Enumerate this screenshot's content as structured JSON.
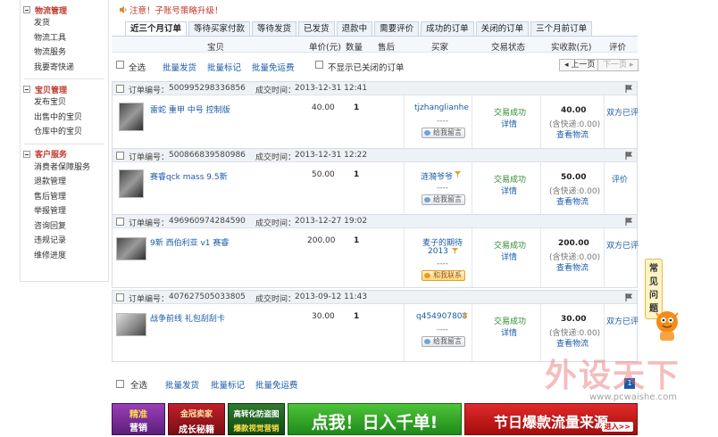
{
  "sidebar": {
    "groups": [
      {
        "title": "物流管理",
        "items": [
          "发货",
          "物流工具",
          "物流服务",
          "我要寄快递"
        ]
      },
      {
        "title": "宝贝管理",
        "items": [
          "发布宝贝",
          "出售中的宝贝",
          "仓库中的宝贝"
        ]
      },
      {
        "title": "客户服务",
        "items": [
          "消费者保障服务",
          "退款管理",
          "售后管理",
          "举报管理",
          "咨询回复",
          "违规记录",
          "维修进度"
        ]
      }
    ]
  },
  "notice": "注意！子账号策略升级！",
  "tabs": [
    "近三个月订单",
    "等待买家付款",
    "等待发货",
    "已发货",
    "退款中",
    "需要评价",
    "成功的订单",
    "关闭的订单",
    "三个月前订单"
  ],
  "columns": {
    "item": "宝贝",
    "price": "单价(元)",
    "qty": "数量",
    "after_sale": "售后",
    "buyer": "买家",
    "status": "交易状态",
    "paid": "实收款(元)",
    "review": "评价"
  },
  "toolbar": {
    "select_all": "全选",
    "batch_ship": "批量发货",
    "batch_mark": "批量标记",
    "batch_free": "批量免运费",
    "hide_closed": "不显示已关闭的订单",
    "prev": "上一页",
    "next": "下一页"
  },
  "orders": [
    {
      "order_label": "订单编号：",
      "order_no": "500995298336856",
      "time_label": "成交时间：",
      "time": "2013-12-31 12:41",
      "item": "雷蛇 重甲 中号 控制版",
      "price": "40.00",
      "qty": "1",
      "buyer": "tjzhanglianhe",
      "buyer2": "",
      "dash": "----",
      "buyer_btn": "给我留言",
      "status": "交易成功",
      "detail": "详情",
      "total": "40.00",
      "shipping": "(含快递:0.00)",
      "logistics": "查看物流",
      "review": "双方已评"
    },
    {
      "order_label": "订单编号：",
      "order_no": "500866839580986",
      "time_label": "成交时间：",
      "time": "2013-12-31 12:22",
      "item": "赛睿qck mass 9.5新",
      "price": "50.00",
      "qty": "1",
      "buyer": "涟漪爷爷",
      "buyer2": "",
      "dash": "----",
      "buyer_btn": "给我留言",
      "status": "交易成功",
      "detail": "详情",
      "total": "50.00",
      "shipping": "(含快递:0.00)",
      "logistics": "查看物流",
      "review": "评价"
    },
    {
      "order_label": "订单编号：",
      "order_no": "496960974284590",
      "time_label": "成交时间：",
      "time": "2013-12-27 19:02",
      "item": "9新 西伯利亚 v1 赛睿",
      "price": "200.00",
      "qty": "1",
      "buyer": "麦子的期待",
      "buyer2": "2013",
      "dash": "----",
      "buyer_btn": "和我联系",
      "status": "交易成功",
      "detail": "详情",
      "total": "200.00",
      "shipping": "(含快递:0.00)",
      "logistics": "查看物流",
      "review": "双方已评"
    },
    {
      "order_label": "订单编号：",
      "order_no": "407627505033805",
      "time_label": "成交时间：",
      "time": "2013-09-12 11:43",
      "item": "战争前线 礼包刮刮卡",
      "price": "30.00",
      "qty": "1",
      "buyer": "q454907808",
      "buyer2": "",
      "dash": "----",
      "buyer_btn": "给我留言",
      "status": "交易成功",
      "detail": "详情",
      "total": "30.00",
      "shipping": "(含快递:0.00)",
      "logistics": "查看物流",
      "review": "双方已评"
    }
  ],
  "bottom": {
    "select_all": "全选",
    "batch_ship": "批量发货",
    "batch_mark": "批量标记",
    "batch_free": "批量免运费",
    "page": "1"
  },
  "banners": {
    "b1a": "精准",
    "b1b": "营销",
    "b2a": "金冠卖家",
    "b2b": "成长秘籍",
    "b3a": "高转化防盗图",
    "b3b": "爆款视觉营销",
    "b4": "点我！日入千单!",
    "b5": "节日爆款流量来源",
    "b5b": "进入>>"
  },
  "faq": [
    "常",
    "见",
    "问",
    "题"
  ],
  "watermark": "外设天下",
  "watermark_url": "www.pcwaishe.com",
  "colors": {
    "accent": "#1a5aa8",
    "alert": "#c0392b",
    "success": "#2e8b2e"
  }
}
